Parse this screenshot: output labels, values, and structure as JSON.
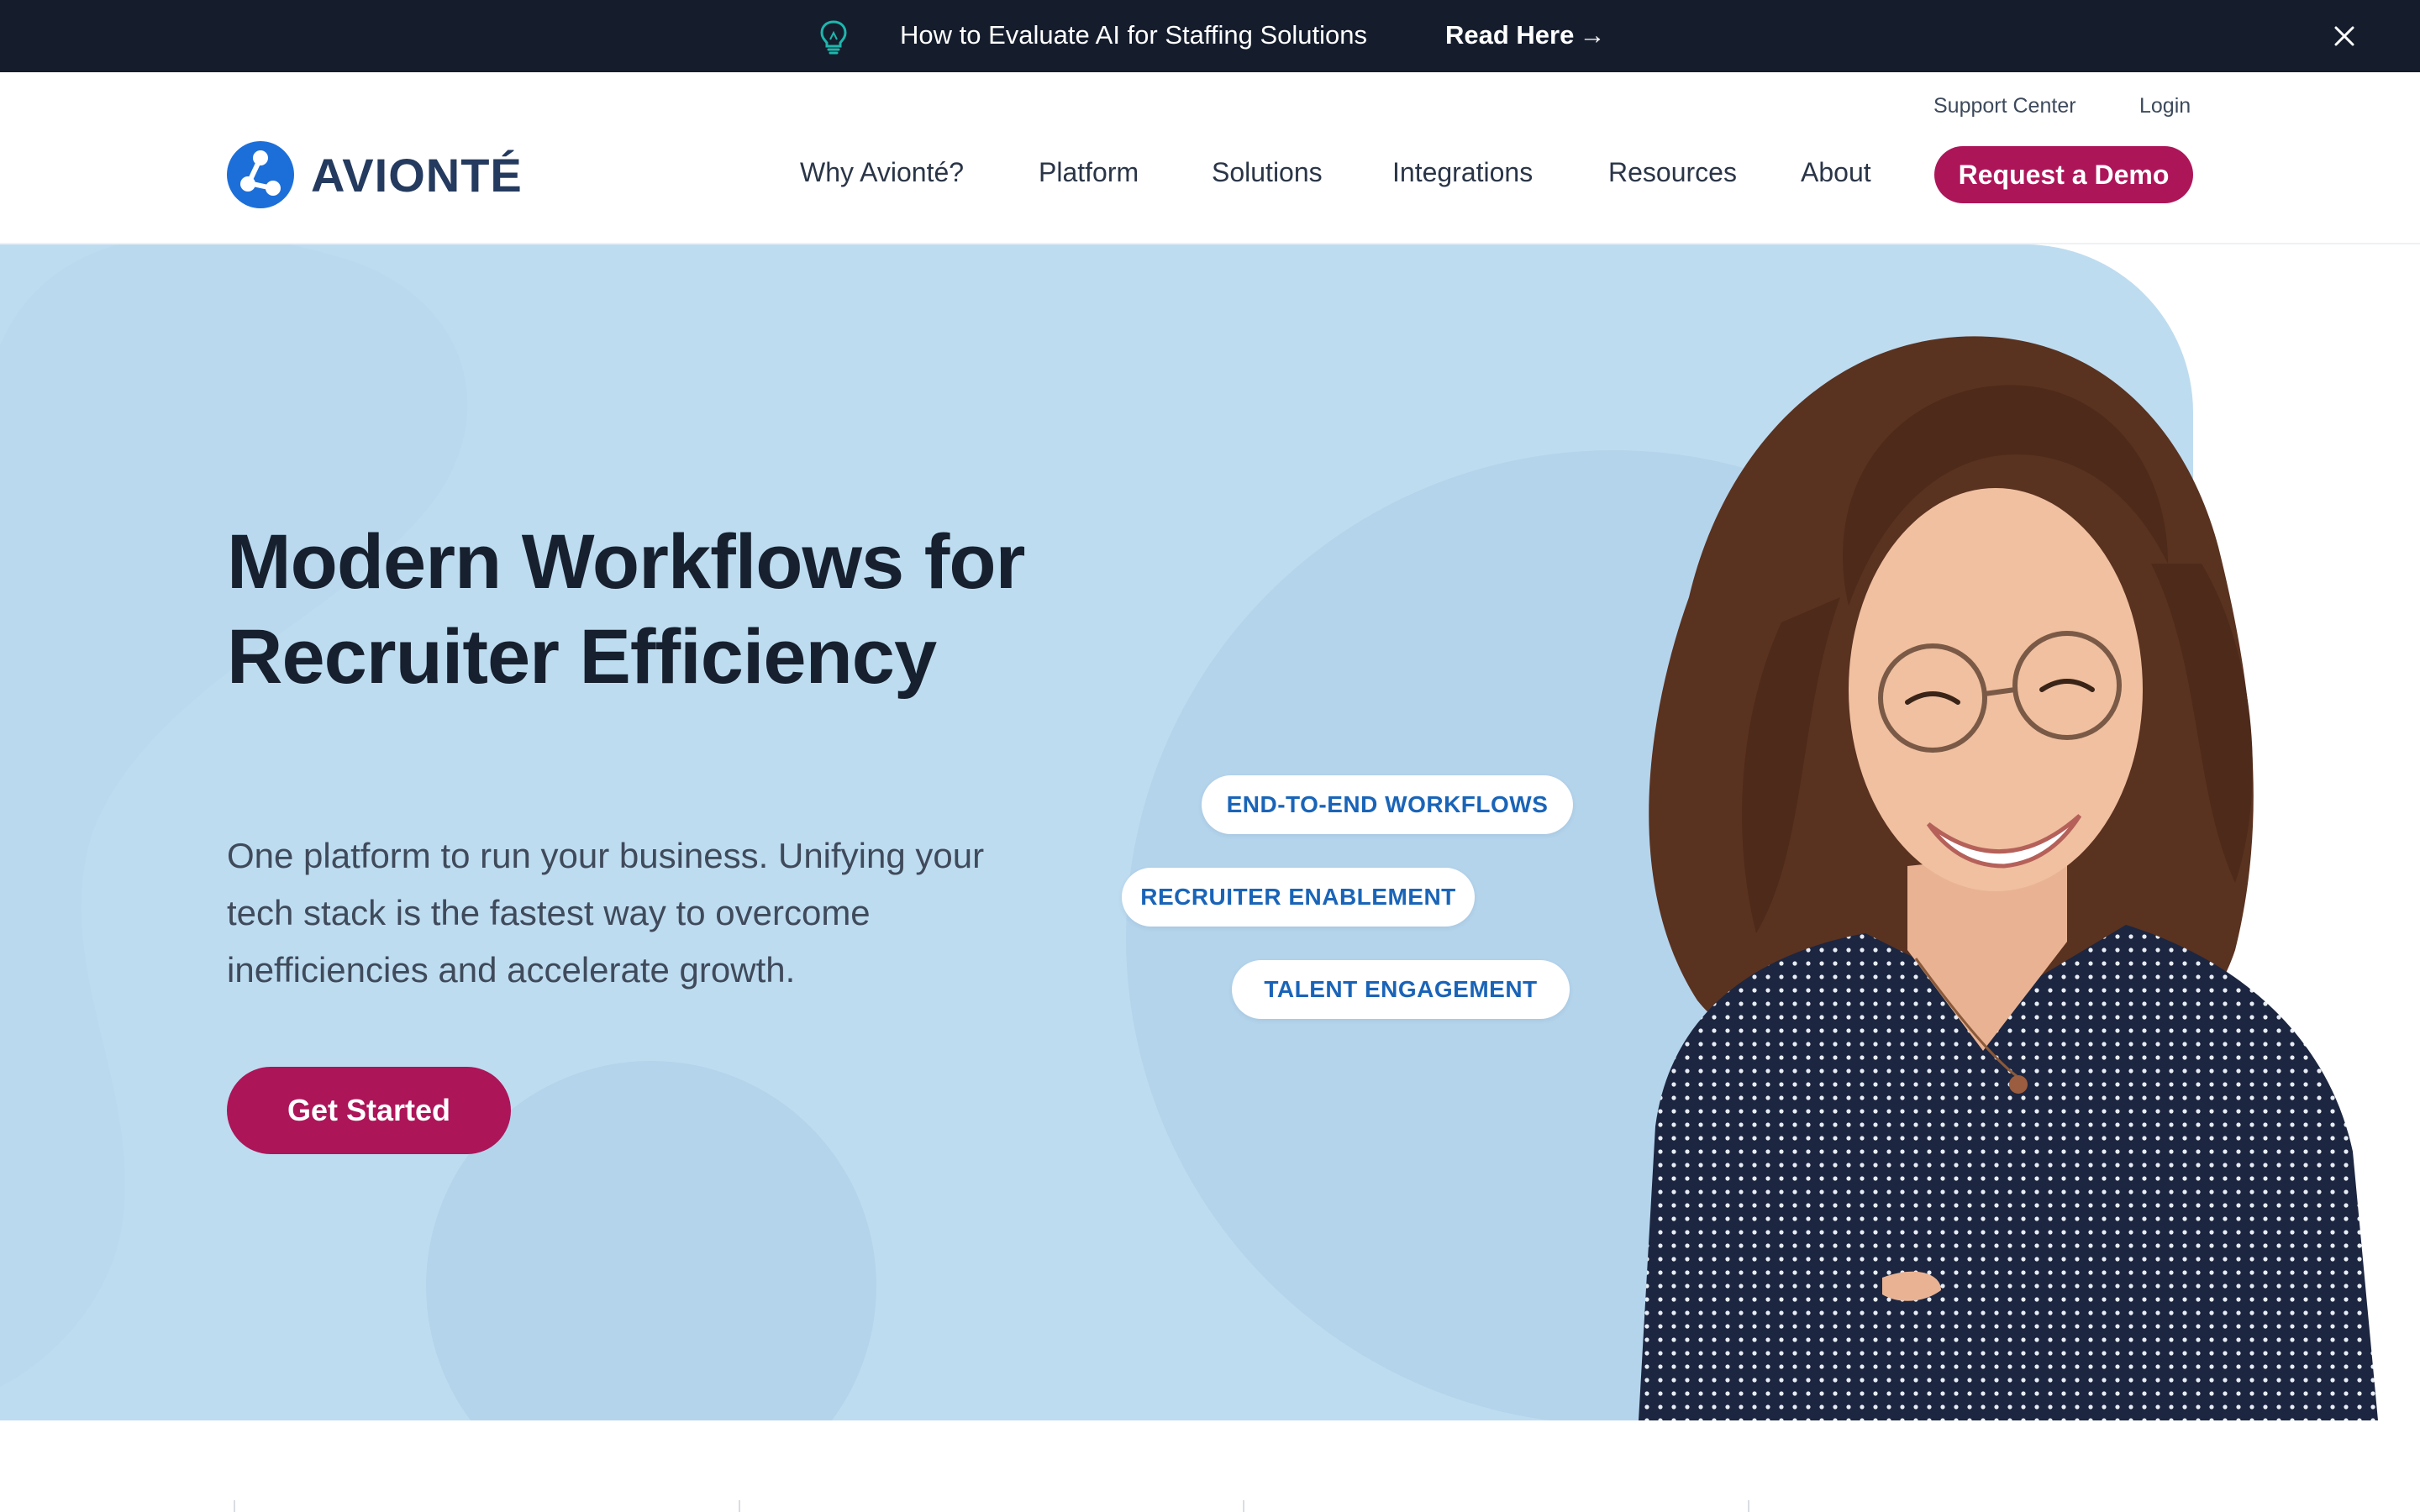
{
  "announcement": {
    "message": "How to Evaluate AI for Staffing Solutions",
    "link_label": "Read Here",
    "link_arrow": "→",
    "icon": "lightbulb-icon",
    "close_icon": "close-icon"
  },
  "header": {
    "logo_text": "AVIONTÉ",
    "utility_links": [
      "Support Center",
      "Login"
    ],
    "nav": [
      "Why Avionté?",
      "Platform",
      "Solutions",
      "Integrations",
      "Resources",
      "About"
    ],
    "cta_label": "Request a Demo"
  },
  "hero": {
    "title": "Modern Workflows for Recruiter Efficiency",
    "subtitle": "One platform to run your business. Unifying your tech stack is the fastest way to overcome inefficiencies and accelerate growth.",
    "cta_label": "Get Started",
    "pills": [
      "END-TO-END WORKFLOWS",
      "RECRUITER ENABLEMENT",
      "TALENT ENGAGEMENT"
    ]
  },
  "colors": {
    "announcement_bg": "#151d2d",
    "brand_magenta": "#ad1559",
    "hero_bg": "#bedcf0",
    "logo_blue": "#1c6fd9",
    "logo_text": "#243a5e",
    "pill_text": "#1a64b8"
  }
}
